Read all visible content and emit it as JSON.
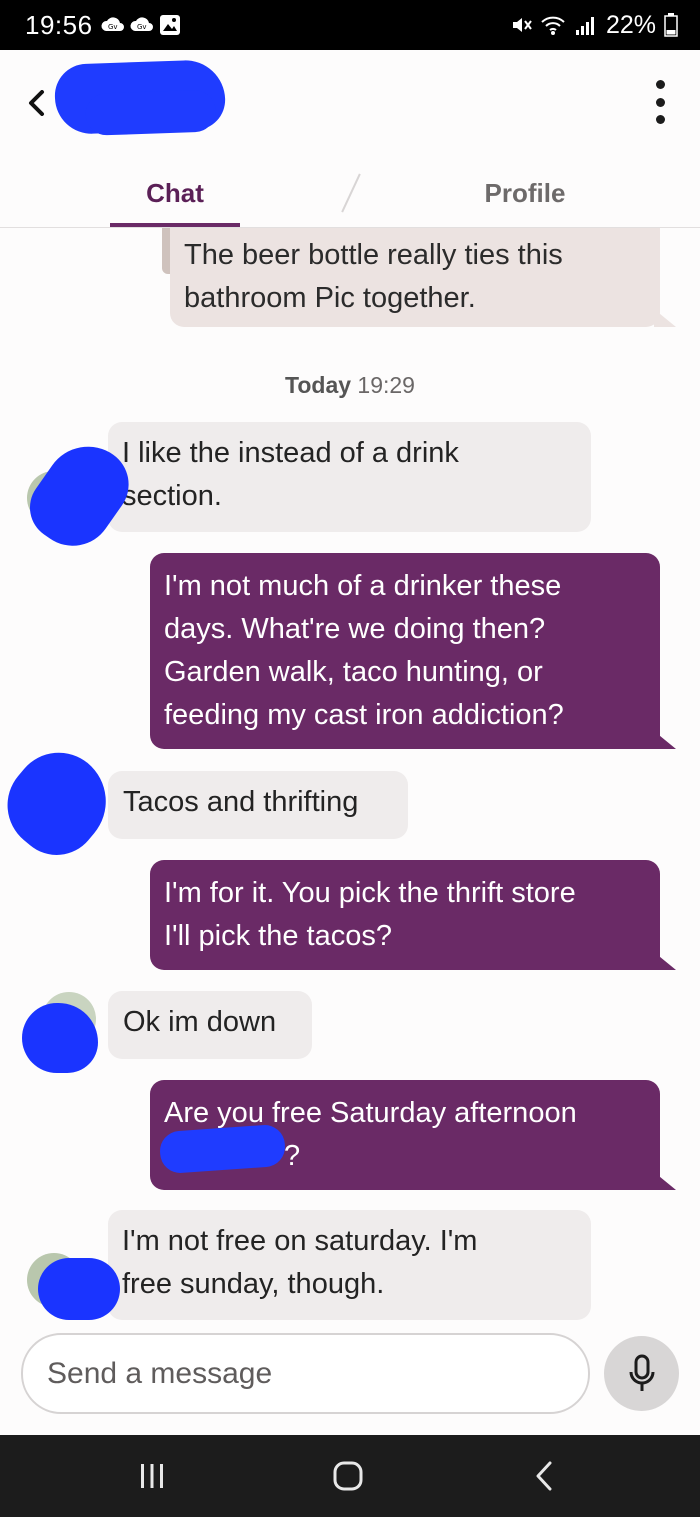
{
  "status_bar": {
    "time": "19:56",
    "battery": "22%",
    "icons": [
      "gv-cloud-icon",
      "gv-cloud-icon",
      "image-icon",
      "mute-icon",
      "wifi-icon",
      "signal-icon",
      "battery-icon"
    ]
  },
  "header": {
    "back_icon": "chevron-left-icon",
    "more_icon": "more-vertical-icon"
  },
  "tabs": [
    {
      "label": "Chat",
      "active": true
    },
    {
      "label": "Profile",
      "active": false
    }
  ],
  "messages": {
    "quoted": {
      "text_1": "The beer bottle really ties this",
      "text_2": "bathroom Pic together."
    },
    "timestamp": {
      "day": "Today",
      "time": "19:29"
    },
    "m1": {
      "from": "them",
      "text_1": "I like the instead of a drink",
      "text_2": "section."
    },
    "m2": {
      "from": "me",
      "text_1": "I'm not much of a drinker these",
      "text_2": "days. What're we doing then?",
      "text_3": "Garden walk, taco hunting, or",
      "text_4": "feeding my cast iron addiction?"
    },
    "m3": {
      "from": "them",
      "text_1": "Tacos and thrifting"
    },
    "m4": {
      "from": "me",
      "text_1": "I'm for it. You pick the thrift store",
      "text_2": "I'll pick the tacos?"
    },
    "m5": {
      "from": "them",
      "text_1": "Ok im down"
    },
    "m6": {
      "from": "me",
      "text_1": "Are you free Saturday afternoon",
      "text_2": "?"
    },
    "m7": {
      "from": "them",
      "text_1": "I'm not free on saturday. I'm",
      "text_2": "free sunday, though."
    }
  },
  "composer": {
    "placeholder": "Send a message",
    "mic_icon": "microphone-icon"
  },
  "nav_bar": {
    "icons": [
      "recent-apps-icon",
      "home-icon",
      "back-icon"
    ]
  },
  "colors": {
    "accent": "#6a2a66",
    "incoming_bubble": "#efecec",
    "quoted_bubble": "#ece3e1",
    "redaction": "#1f3cff"
  }
}
